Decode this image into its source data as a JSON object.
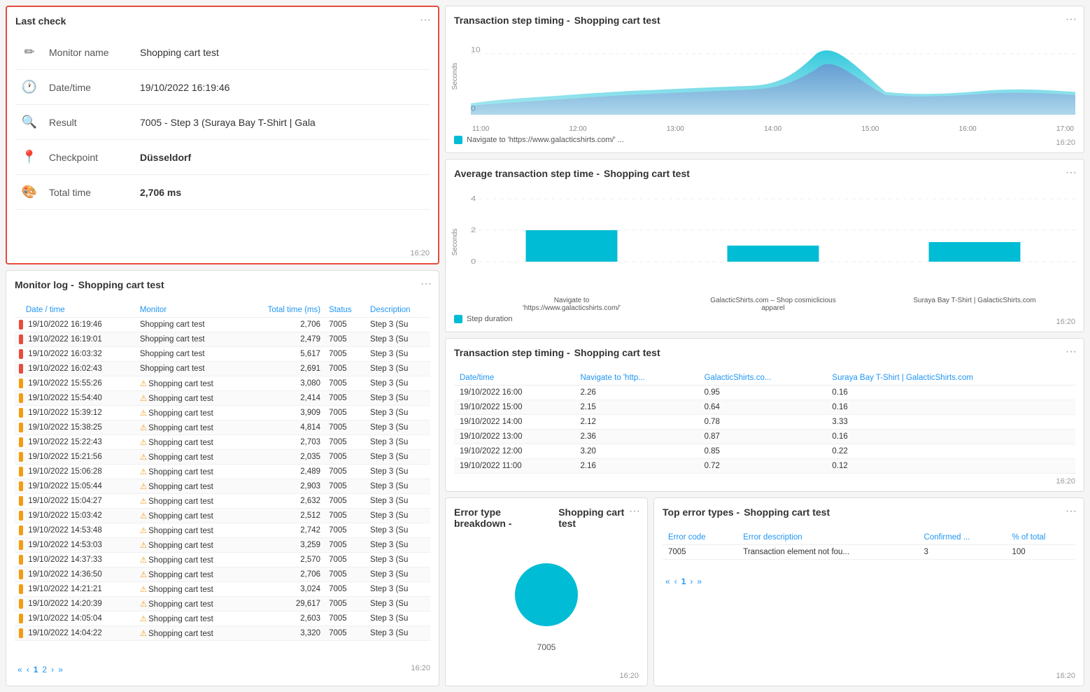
{
  "lastCheck": {
    "title": "Last check",
    "menuIcon": "···",
    "timestamp": "16:20",
    "fields": [
      {
        "icon": "✏",
        "label": "Monitor name",
        "value": "Shopping cart test",
        "bold": false
      },
      {
        "icon": "🕐",
        "label": "Date/time",
        "value": "19/10/2022 16:19:46",
        "bold": false
      },
      {
        "icon": "🔍",
        "label": "Result",
        "value": "7005 - Step 3 (Suraya Bay T-Shirt | Gala",
        "bold": false
      },
      {
        "icon": "📍",
        "label": "Checkpoint",
        "value": "Düsseldorf",
        "bold": true
      },
      {
        "icon": "🎨",
        "label": "Total time",
        "value": "2,706 ms",
        "bold": true
      }
    ]
  },
  "monitorLog": {
    "title": "Monitor log -",
    "monitorName": "Shopping cart test",
    "menuIcon": "···",
    "timestamp": "16:20",
    "columns": [
      "Date / time",
      "Monitor",
      "Total time (ms)",
      "Status",
      "Description"
    ],
    "rows": [
      {
        "indicator": "red",
        "datetime": "19/10/2022 16:19:46",
        "monitor": "Shopping cart test",
        "totalTime": "2,706",
        "status": "7005",
        "description": "Step 3 (Su",
        "icon": "none"
      },
      {
        "indicator": "red",
        "datetime": "19/10/2022 16:19:01",
        "monitor": "Shopping cart test",
        "totalTime": "2,479",
        "status": "7005",
        "description": "Step 3 (Su",
        "icon": "none"
      },
      {
        "indicator": "red",
        "datetime": "19/10/2022 16:03:32",
        "monitor": "Shopping cart test",
        "totalTime": "5,617",
        "status": "7005",
        "description": "Step 3 (Su",
        "icon": "none"
      },
      {
        "indicator": "red",
        "datetime": "19/10/2022 16:02:43",
        "monitor": "Shopping cart test",
        "totalTime": "2,691",
        "status": "7005",
        "description": "Step 3 (Su",
        "icon": "none"
      },
      {
        "indicator": "orange",
        "datetime": "19/10/2022 15:55:26",
        "monitor": "Shopping cart test",
        "totalTime": "3,080",
        "status": "7005",
        "description": "Step 3 (Su",
        "icon": "warning"
      },
      {
        "indicator": "orange",
        "datetime": "19/10/2022 15:54:40",
        "monitor": "Shopping cart test",
        "totalTime": "2,414",
        "status": "7005",
        "description": "Step 3 (Su",
        "icon": "warning"
      },
      {
        "indicator": "orange",
        "datetime": "19/10/2022 15:39:12",
        "monitor": "Shopping cart test",
        "totalTime": "3,909",
        "status": "7005",
        "description": "Step 3 (Su",
        "icon": "warning"
      },
      {
        "indicator": "orange",
        "datetime": "19/10/2022 15:38:25",
        "monitor": "Shopping cart test",
        "totalTime": "4,814",
        "status": "7005",
        "description": "Step 3 (Su",
        "icon": "warning"
      },
      {
        "indicator": "orange",
        "datetime": "19/10/2022 15:22:43",
        "monitor": "Shopping cart test",
        "totalTime": "2,703",
        "status": "7005",
        "description": "Step 3 (Su",
        "icon": "warning"
      },
      {
        "indicator": "orange",
        "datetime": "19/10/2022 15:21:56",
        "monitor": "Shopping cart test",
        "totalTime": "2,035",
        "status": "7005",
        "description": "Step 3 (Su",
        "icon": "warning"
      },
      {
        "indicator": "orange",
        "datetime": "19/10/2022 15:06:28",
        "monitor": "Shopping cart test",
        "totalTime": "2,489",
        "status": "7005",
        "description": "Step 3 (Su",
        "icon": "warning"
      },
      {
        "indicator": "orange",
        "datetime": "19/10/2022 15:05:44",
        "monitor": "Shopping cart test",
        "totalTime": "2,903",
        "status": "7005",
        "description": "Step 3 (Su",
        "icon": "warning"
      },
      {
        "indicator": "orange",
        "datetime": "19/10/2022 15:04:27",
        "monitor": "Shopping cart test",
        "totalTime": "2,632",
        "status": "7005",
        "description": "Step 3 (Su",
        "icon": "warning"
      },
      {
        "indicator": "orange",
        "datetime": "19/10/2022 15:03:42",
        "monitor": "Shopping cart test",
        "totalTime": "2,512",
        "status": "7005",
        "description": "Step 3 (Su",
        "icon": "warning"
      },
      {
        "indicator": "orange",
        "datetime": "19/10/2022 14:53:48",
        "monitor": "Shopping cart test",
        "totalTime": "2,742",
        "status": "7005",
        "description": "Step 3 (Su",
        "icon": "warning"
      },
      {
        "indicator": "orange",
        "datetime": "19/10/2022 14:53:03",
        "monitor": "Shopping cart test",
        "totalTime": "3,259",
        "status": "7005",
        "description": "Step 3 (Su",
        "icon": "warning"
      },
      {
        "indicator": "orange",
        "datetime": "19/10/2022 14:37:33",
        "monitor": "Shopping cart test",
        "totalTime": "2,570",
        "status": "7005",
        "description": "Step 3 (Su",
        "icon": "warning"
      },
      {
        "indicator": "orange",
        "datetime": "19/10/2022 14:36:50",
        "monitor": "Shopping cart test",
        "totalTime": "2,706",
        "status": "7005",
        "description": "Step 3 (Su",
        "icon": "warning"
      },
      {
        "indicator": "orange",
        "datetime": "19/10/2022 14:21:21",
        "monitor": "Shopping cart test",
        "totalTime": "3,024",
        "status": "7005",
        "description": "Step 3 (Su",
        "icon": "warning"
      },
      {
        "indicator": "orange",
        "datetime": "19/10/2022 14:20:39",
        "monitor": "Shopping cart test",
        "totalTime": "29,617",
        "status": "7005",
        "description": "Step 3 (Su",
        "icon": "warning"
      },
      {
        "indicator": "orange",
        "datetime": "19/10/2022 14:05:04",
        "monitor": "Shopping cart test",
        "totalTime": "2,603",
        "status": "7005",
        "description": "Step 3 (Su",
        "icon": "warning"
      },
      {
        "indicator": "orange",
        "datetime": "19/10/2022 14:04:22",
        "monitor": "Shopping cart test",
        "totalTime": "3,320",
        "status": "7005",
        "description": "Step 3 (Su",
        "icon": "warning"
      }
    ],
    "pagination": {
      "prev": "«",
      "prevOne": "‹",
      "currentPage": "1",
      "nextOne": "›",
      "next": "»"
    }
  },
  "txStepTimingChart": {
    "title": "Transaction step timing -",
    "monitorName": "Shopping cart test",
    "menuIcon": "···",
    "timestamp": "16:20",
    "xLabels": [
      "11:00",
      "12:00",
      "13:00",
      "14:00",
      "15:00",
      "16:00",
      "17:00"
    ],
    "yLabels": [
      "10",
      "0"
    ],
    "legend": "Navigate to 'https://www.galacticshirts.com/' ...",
    "legendColor": "#00BCD4"
  },
  "avgStepTimeChart": {
    "title": "Average transaction step time -",
    "monitorName": "Shopping cart test",
    "menuIcon": "···",
    "timestamp": "16:20",
    "yLabels": [
      "4",
      "2",
      "0"
    ],
    "bars": [
      {
        "label": "Navigate to\n'https://www.galacticshirts.com/'",
        "value": 2.0,
        "color": "#00BCD4"
      },
      {
        "label": "GalacticShirts.com - Shop cosmiclicious\napparel",
        "value": 0.9,
        "color": "#00BCD4"
      },
      {
        "label": "Suraya Bay T-Shirt | GalacticShirts.com",
        "value": 1.1,
        "color": "#00BCD4"
      }
    ],
    "legend": "Step duration",
    "legendColor": "#00BCD4"
  },
  "stepTimingTable": {
    "title": "Transaction step timing -",
    "monitorName": "Shopping cart test",
    "menuIcon": "···",
    "timestamp": "16:20",
    "columns": [
      "Date/time",
      "Navigate to 'http...",
      "GalacticShirts.co...",
      "Suraya Bay T-Shirt | GalacticShirts.com"
    ],
    "rows": [
      {
        "datetime": "19/10/2022 16:00",
        "nav": "2.26",
        "galactic": "0.95",
        "suraya": "0.16"
      },
      {
        "datetime": "19/10/2022 15:00",
        "nav": "2.15",
        "galactic": "0.64",
        "suraya": "0.16"
      },
      {
        "datetime": "19/10/2022 14:00",
        "nav": "2.12",
        "galactic": "0.78",
        "suraya": "3.33"
      },
      {
        "datetime": "19/10/2022 13:00",
        "nav": "2.36",
        "galactic": "0.87",
        "suraya": "0.16"
      },
      {
        "datetime": "19/10/2022 12:00",
        "nav": "3.20",
        "galactic": "0.85",
        "suraya": "0.22"
      },
      {
        "datetime": "19/10/2022 11:00",
        "nav": "2.16",
        "galactic": "0.72",
        "suraya": "0.12"
      }
    ]
  },
  "errorBreakdown": {
    "title": "Error type breakdown -",
    "monitorName": "Shopping cart test",
    "menuIcon": "···",
    "donutLabel": "7005",
    "donutColor": "#00BCD4",
    "timestamp": "16:20"
  },
  "topErrorTypes": {
    "title": "Top error types -",
    "monitorName": "Shopping cart test",
    "menuIcon": "···",
    "timestamp": "16:20",
    "columns": [
      "Error code",
      "Error description",
      "Confirmed ...",
      "% of total"
    ],
    "rows": [
      {
        "code": "7005",
        "description": "Transaction element not fou...",
        "confirmed": "3",
        "percent": "100"
      }
    ],
    "pagination": {
      "prev": "«",
      "prevOne": "‹",
      "currentPage": "1",
      "nextOne": "›",
      "next": "»"
    }
  },
  "colors": {
    "red": "#e74c3c",
    "orange": "#f39c12",
    "cyan": "#00BCD4",
    "blue": "#2196F3",
    "darkGray": "#555",
    "lightGray": "#eee"
  }
}
